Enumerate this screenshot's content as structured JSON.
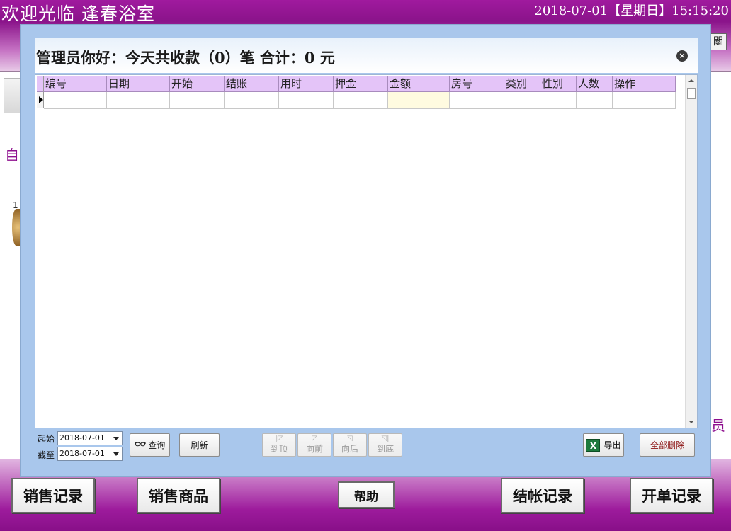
{
  "app": {
    "title": "欢迎光临 逢春浴室",
    "clock": "2018-07-01【星期日】15:15:20"
  },
  "background": {
    "left_char": "自",
    "left_small": "1",
    "right_char": "员",
    "right_btn": "關"
  },
  "dialog": {
    "title": "管理员你好：今天共收款（0）笔 合计：0 元",
    "close_label": "×",
    "grid": {
      "columns": [
        "编号",
        "日期",
        "开始",
        "结账",
        "用时",
        "押金",
        "金额",
        "房号",
        "类别",
        "性别",
        "人数",
        "操作"
      ],
      "rows": [
        [
          "",
          "",
          "",
          "",
          "",
          "",
          "",
          "",
          "",
          "",
          "",
          ""
        ]
      ]
    },
    "filters": {
      "start_label": "起始",
      "start_value": "2018-07-01",
      "end_label": "截至",
      "end_value": "2018-07-01"
    },
    "buttons": {
      "query": "查询",
      "refresh": "刷新",
      "first": "到顶",
      "prev": "向前",
      "next": "向后",
      "last": "到底",
      "export": "导出",
      "delete_all": "全部删除"
    }
  },
  "bottom_nav": {
    "sales_records": "销售记录",
    "sales_goods": "销售商品",
    "help": "帮助",
    "checkout_records": "结帐记录",
    "order_records": "开单记录"
  },
  "colors": {
    "brand_purple": "#8a138a",
    "header_purple": "#e4c4f8",
    "dialog_blue": "#a9c7ec"
  }
}
